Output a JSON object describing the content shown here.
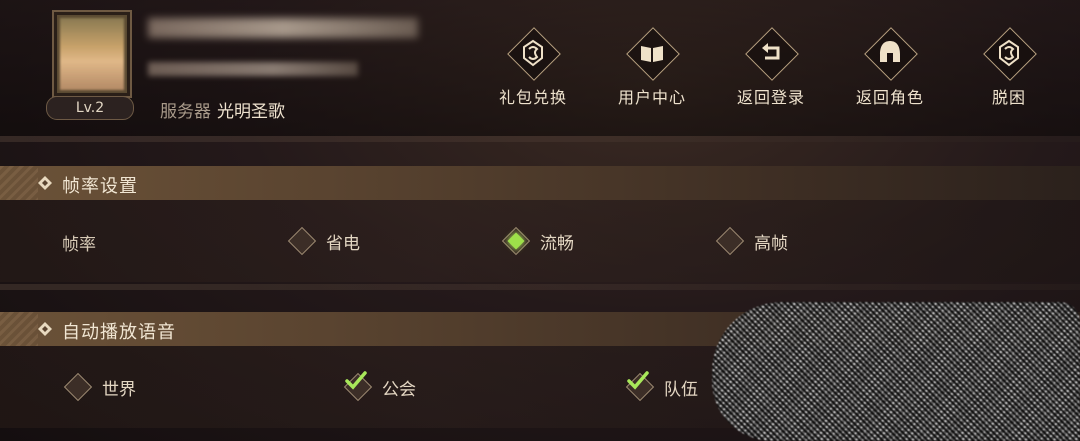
{
  "profile": {
    "level": "Lv.2",
    "server_label": "服务器",
    "server_name": "光明圣歌"
  },
  "actions": [
    {
      "label": "礼包兑换",
      "icon": "gift-crest-icon"
    },
    {
      "label": "用户中心",
      "icon": "book-icon"
    },
    {
      "label": "返回登录",
      "icon": "return-arrow-icon"
    },
    {
      "label": "返回角色",
      "icon": "helmet-icon"
    },
    {
      "label": "脱困",
      "icon": "escape-crest-icon"
    }
  ],
  "framerate": {
    "title": "帧率设置",
    "row_label": "帧率",
    "options": [
      {
        "label": "省电",
        "selected": false
      },
      {
        "label": "流畅",
        "selected": true
      },
      {
        "label": "高帧",
        "selected": false
      }
    ]
  },
  "voice": {
    "title": "自动播放语音",
    "options": [
      {
        "label": "世界",
        "checked": false
      },
      {
        "label": "公会",
        "checked": true
      },
      {
        "label": "队伍",
        "checked": true
      }
    ]
  },
  "colors": {
    "accent_green": "#9ee04a",
    "header_gold": "#6b5238",
    "text": "#e8dcc9"
  }
}
